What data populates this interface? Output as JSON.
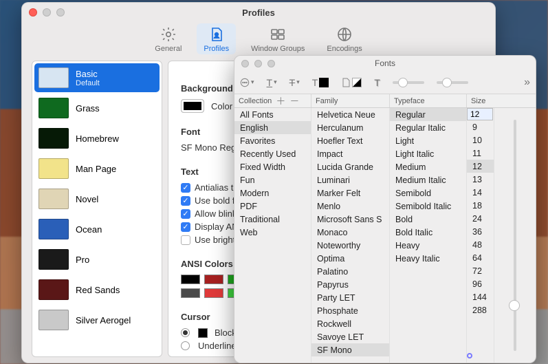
{
  "profiles_window": {
    "title": "Profiles",
    "toolbar": [
      {
        "id": "general",
        "label": "General"
      },
      {
        "id": "profiles",
        "label": "Profiles",
        "selected": true
      },
      {
        "id": "window-groups",
        "label": "Window Groups"
      },
      {
        "id": "encodings",
        "label": "Encodings"
      }
    ],
    "sidebar": [
      {
        "name": "Basic",
        "sub": "Default",
        "selected": true,
        "thumb_bg": "#d7e5f2"
      },
      {
        "name": "Grass",
        "thumb_bg": "#0f6a1f"
      },
      {
        "name": "Homebrew",
        "thumb_bg": "#061a06"
      },
      {
        "name": "Man Page",
        "thumb_bg": "#f2e38a"
      },
      {
        "name": "Novel",
        "thumb_bg": "#e0d5b5"
      },
      {
        "name": "Ocean",
        "thumb_bg": "#2a5fb8"
      },
      {
        "name": "Pro",
        "thumb_bg": "#1a1a1a"
      },
      {
        "name": "Red Sands",
        "thumb_bg": "#5a1717"
      },
      {
        "name": "Silver Aerogel",
        "thumb_bg": "#c9c9c9"
      }
    ],
    "content": {
      "tab_label": "Text",
      "background": {
        "heading": "Background",
        "label": "Color & Effects"
      },
      "font": {
        "heading": "Font",
        "value": "SF Mono Regular"
      },
      "text": {
        "heading": "Text",
        "options": [
          {
            "label": "Antialias text",
            "checked": true
          },
          {
            "label": "Use bold fonts",
            "checked": true
          },
          {
            "label": "Allow blinking text",
            "checked": true
          },
          {
            "label": "Display ANSI colors",
            "checked": true
          },
          {
            "label": "Use bright colors for bold text",
            "checked": false
          }
        ]
      },
      "ansi": {
        "heading": "ANSI Colors",
        "row1": [
          "#000000",
          "#a62020",
          "#1fa81f"
        ],
        "row2": [
          "#4a4a4a",
          "#e03a3a",
          "#3fd23f"
        ]
      },
      "cursor": {
        "heading": "Cursor",
        "options": [
          {
            "label": "Block",
            "selected": true
          },
          {
            "label": "Underline",
            "selected": false
          }
        ]
      }
    }
  },
  "fonts_window": {
    "title": "Fonts",
    "headers": {
      "collection": "Collection",
      "family": "Family",
      "typeface": "Typeface",
      "size": "Size"
    },
    "collections": [
      {
        "label": "All Fonts"
      },
      {
        "label": "English",
        "selected": true
      },
      {
        "label": "Favorites"
      },
      {
        "label": "Recently Used"
      },
      {
        "label": "Fixed Width"
      },
      {
        "label": "Fun"
      },
      {
        "label": "Modern"
      },
      {
        "label": "PDF"
      },
      {
        "label": "Traditional"
      },
      {
        "label": "Web"
      }
    ],
    "families": [
      "Helvetica Neue",
      "Herculanum",
      "Hoefler Text",
      "Impact",
      "Lucida Grande",
      "Luminari",
      "Marker Felt",
      "Menlo",
      "Microsoft Sans S",
      "Monaco",
      "Noteworthy",
      "Optima",
      "Palatino",
      "Papyrus",
      "Party LET",
      "Phosphate",
      "Rockwell",
      "Savoye LET",
      "SF Mono"
    ],
    "family_selected": "SF Mono",
    "typefaces": [
      {
        "label": "Regular",
        "selected": true
      },
      {
        "label": "Regular Italic"
      },
      {
        "label": "Light"
      },
      {
        "label": "Light Italic"
      },
      {
        "label": "Medium"
      },
      {
        "label": "Medium Italic"
      },
      {
        "label": "Semibold"
      },
      {
        "label": "Semibold Italic"
      },
      {
        "label": "Bold"
      },
      {
        "label": "Bold Italic"
      },
      {
        "label": "Heavy"
      },
      {
        "label": "Heavy Italic"
      }
    ],
    "size_value": "12",
    "sizes": [
      "9",
      "10",
      "11",
      "12",
      "13",
      "14",
      "18",
      "24",
      "36",
      "48",
      "64",
      "72",
      "96",
      "144",
      "288"
    ],
    "size_selected": "12"
  }
}
